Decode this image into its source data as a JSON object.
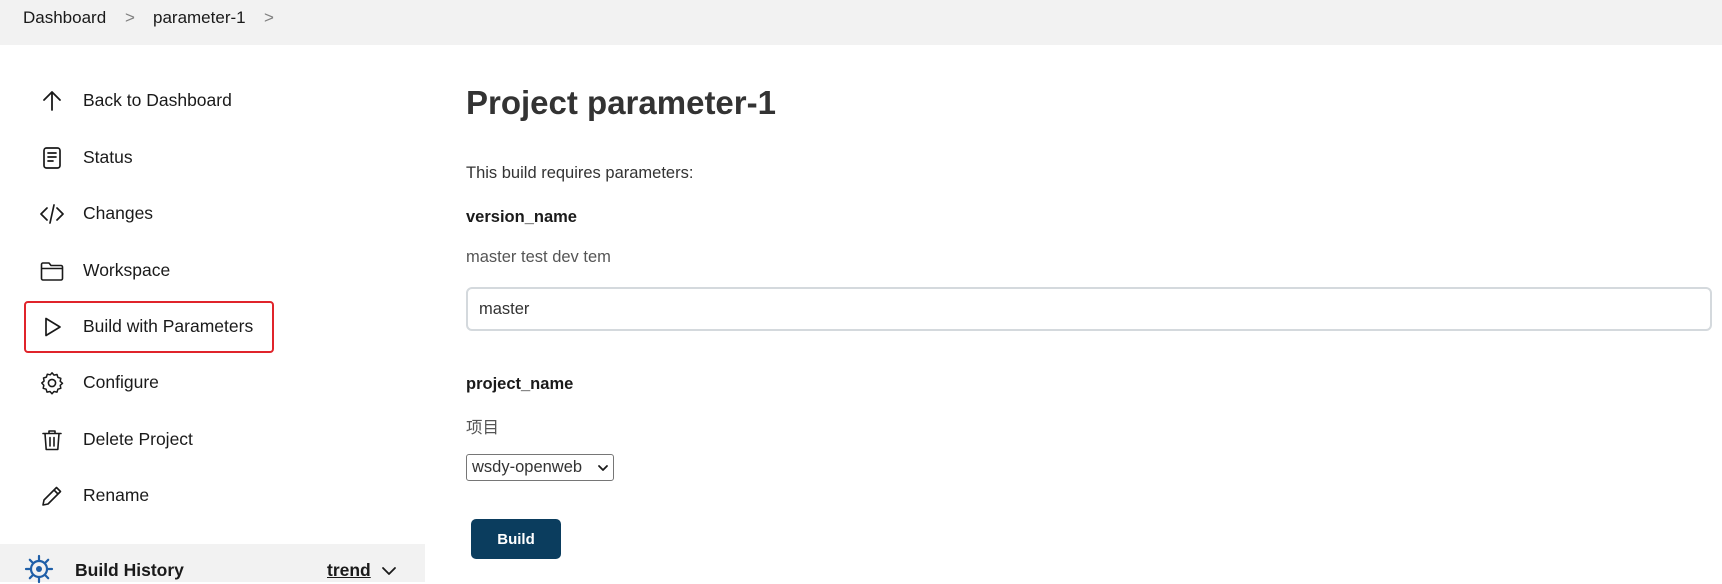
{
  "breadcrumb": {
    "items": [
      "Dashboard",
      "parameter-1"
    ],
    "separator": ">"
  },
  "sidebar": {
    "items": [
      {
        "label": "Back to Dashboard",
        "icon": "arrow-up-icon"
      },
      {
        "label": "Status",
        "icon": "document-icon"
      },
      {
        "label": "Changes",
        "icon": "code-icon"
      },
      {
        "label": "Workspace",
        "icon": "folder-icon"
      },
      {
        "label": "Build with Parameters",
        "icon": "play-icon",
        "active": true
      },
      {
        "label": "Configure",
        "icon": "gear-icon"
      },
      {
        "label": "Delete Project",
        "icon": "trash-icon"
      },
      {
        "label": "Rename",
        "icon": "pencil-icon"
      }
    ],
    "build_history": {
      "label": "Build History",
      "trend_label": "trend",
      "icon": "build-history-icon"
    }
  },
  "main": {
    "title": "Project parameter-1",
    "intro": "This build requires parameters:",
    "params": [
      {
        "name": "version_name",
        "description": "master test dev tem",
        "value": "master",
        "type": "string"
      },
      {
        "name": "project_name",
        "description": "项目",
        "value": "wsdy-openweb",
        "type": "choice"
      }
    ],
    "build_button": "Build"
  },
  "colors": {
    "accent": "#0b3d5e",
    "active_outline": "#e0242b",
    "breadcrumb_bg": "#f2f2f2"
  }
}
